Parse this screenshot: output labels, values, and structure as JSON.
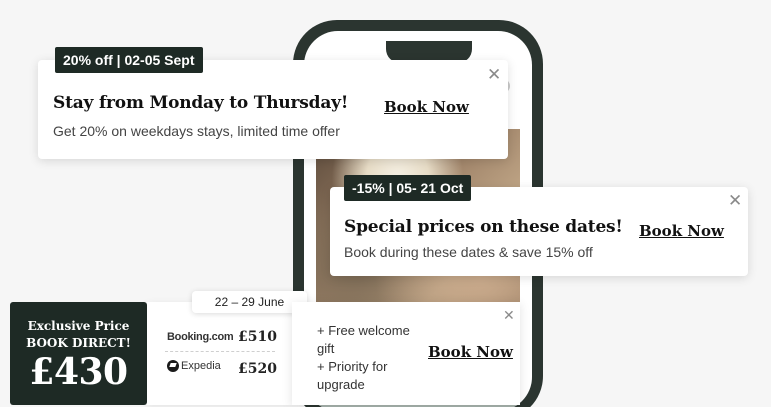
{
  "offer1": {
    "tag": "20% off  | 02-05 Sept",
    "title": "Stay from Monday to Thursday!",
    "subtitle": "Get 20% on weekdays stays, limited time offer",
    "cta": "Book Now",
    "close_icon": "close-icon"
  },
  "offer2": {
    "tag": "-15% | 05- 21 Oct",
    "title": "Special prices on these dates!",
    "subtitle": "Book during these dates & save 15% off",
    "cta": "Book Now",
    "close_icon": "close-icon"
  },
  "price_widget": {
    "label_line1": "Exclusive Price",
    "label_line2": "BOOK DIRECT!",
    "price": "£430",
    "date_range": "22 – 29 June",
    "comparisons": [
      {
        "site": "Booking.com",
        "price": "£510"
      },
      {
        "site": "Expedia",
        "price": "£520"
      }
    ],
    "benefits": [
      "+ Free welcome",
      "gift",
      "+ Priority for",
      "upgrade"
    ],
    "cta": "Book Now"
  },
  "colors": {
    "dark": "#1e2a25",
    "background": "#f6f6f6",
    "card": "#ffffff"
  }
}
